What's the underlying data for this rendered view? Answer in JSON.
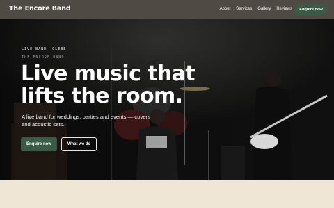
{
  "header": {
    "brand": "The Encore Band",
    "nav": [
      "About",
      "Services",
      "Gallery",
      "Reviews"
    ],
    "cta": "Enquire now"
  },
  "hero": {
    "eyebrow": [
      "LIVE BAND",
      "GLEBE"
    ],
    "subeyebrow": "THE ENCORE BAND",
    "headline": [
      "Live music that",
      "lifts the room."
    ],
    "lede": "A live band for weddings, parties and events — covers and acoustic sets.",
    "primary_cta": "Enquire now",
    "secondary_cta": "What we do"
  },
  "colors": {
    "header_bg": "#504a44",
    "accent_green": "#3b5b46",
    "page_bg": "#efe6d6"
  }
}
